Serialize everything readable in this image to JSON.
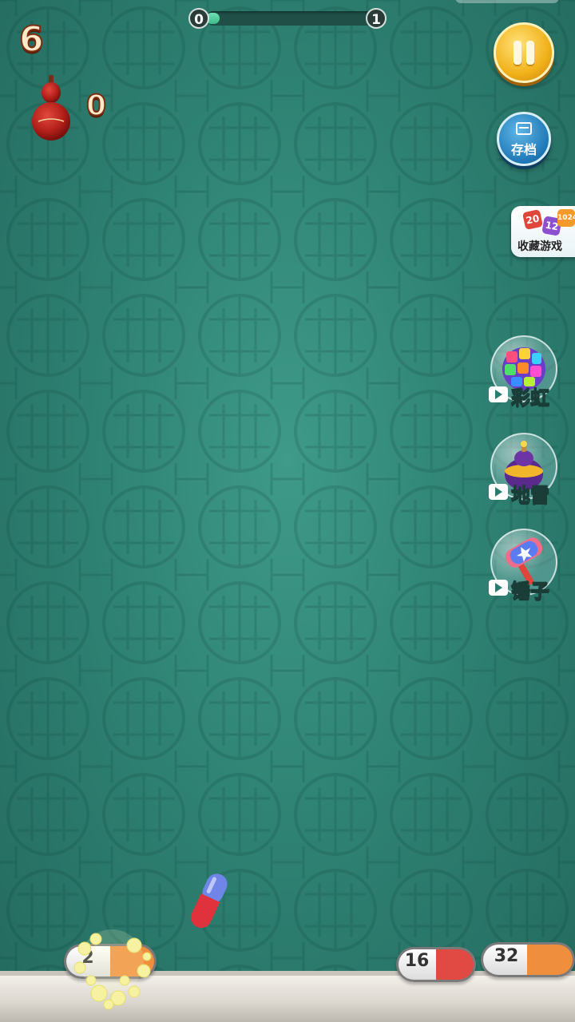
{
  "hud": {
    "score": "6",
    "gourd_count": "0",
    "progress": {
      "start_label": "0",
      "end_label": "1",
      "fraction": 0.08
    }
  },
  "buttons": {
    "pause_icon": "pause-icon",
    "save_label": "存档",
    "collect_label": "收藏游戏",
    "collect_tiles": [
      "20",
      "12",
      "1024"
    ]
  },
  "powerups": [
    {
      "label": "彩虹",
      "icon": "rainbow-ball-icon"
    },
    {
      "label": "地雷",
      "icon": "bomb-icon"
    },
    {
      "label": "锤子",
      "icon": "hammer-icon"
    }
  ],
  "tray": [
    {
      "value": "2",
      "right_color": "#ef8f3e"
    },
    {
      "value": "16",
      "right_color": "#e04a43"
    },
    {
      "value": "32",
      "right_color": "#ef8f3e"
    }
  ],
  "falling_pill": {
    "top_color": "#6f86e8",
    "bottom_color": "#e0323c"
  },
  "colors": {
    "background": "#2f8374",
    "gold": "#f1b21b",
    "save_blue": "#1f78b6"
  }
}
